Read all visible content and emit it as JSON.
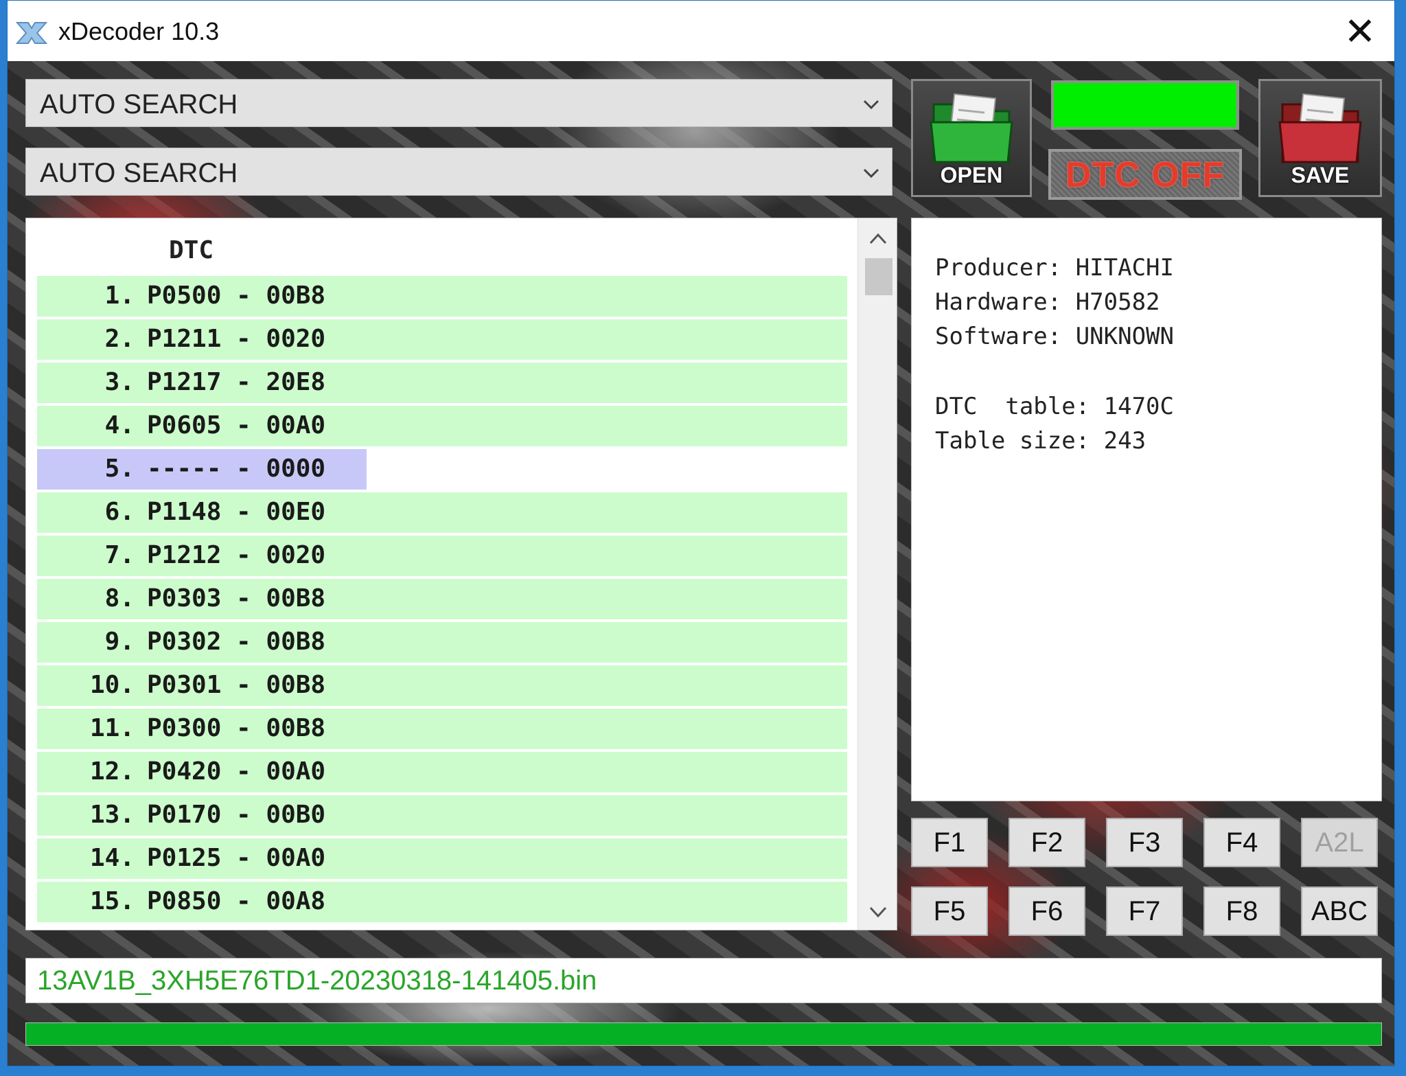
{
  "window": {
    "title": "xDecoder 10.3"
  },
  "combos": [
    {
      "value": "AUTO SEARCH"
    },
    {
      "value": "AUTO SEARCH"
    }
  ],
  "toolbar": {
    "open_label": "OPEN",
    "save_label": "SAVE",
    "dtc_off_label": "DTC OFF",
    "status_color": "#00ee00"
  },
  "dtc_list": {
    "header": "DTC",
    "rows": [
      {
        "num": "1.",
        "code": "P0500 - 00B8"
      },
      {
        "num": "2.",
        "code": "P1211 - 0020"
      },
      {
        "num": "3.",
        "code": "P1217 - 20E8"
      },
      {
        "num": "4.",
        "code": "P0605 - 00A0"
      },
      {
        "num": "5.",
        "code": "----- - 0000"
      },
      {
        "num": "6.",
        "code": "P1148 - 00E0"
      },
      {
        "num": "7.",
        "code": "P1212 - 0020"
      },
      {
        "num": "8.",
        "code": "P0303 - 00B8"
      },
      {
        "num": "9.",
        "code": "P0302 - 00B8"
      },
      {
        "num": "10.",
        "code": "P0301 - 00B8"
      },
      {
        "num": "11.",
        "code": "P0300 - 00B8"
      },
      {
        "num": "12.",
        "code": "P0420 - 00A0"
      },
      {
        "num": "13.",
        "code": "P0170 - 00B0"
      },
      {
        "num": "14.",
        "code": "P0125 - 00A0"
      },
      {
        "num": "15.",
        "code": "P0850 - 00A8"
      }
    ],
    "selected_row": 5,
    "row_color": "#ccfccc",
    "selected_color": "#c8c8f8"
  },
  "info": {
    "producer": "Producer: HITACHI",
    "hardware": "Hardware: H70582",
    "software": "Software: UNKNOWN",
    "dtc_table": "DTC  table: 1470C",
    "table_size": "Table size: 243"
  },
  "fkeys": {
    "f1": "F1",
    "f2": "F2",
    "f3": "F3",
    "f4": "F4",
    "a2l": "A2L",
    "f5": "F5",
    "f6": "F6",
    "f7": "F7",
    "f8": "F8",
    "abc": "ABC"
  },
  "file": {
    "name": "13AV1B_3XH5E76TD1-20230318-141405.bin"
  },
  "progress": {
    "percent": 100,
    "color": "#06b025"
  }
}
